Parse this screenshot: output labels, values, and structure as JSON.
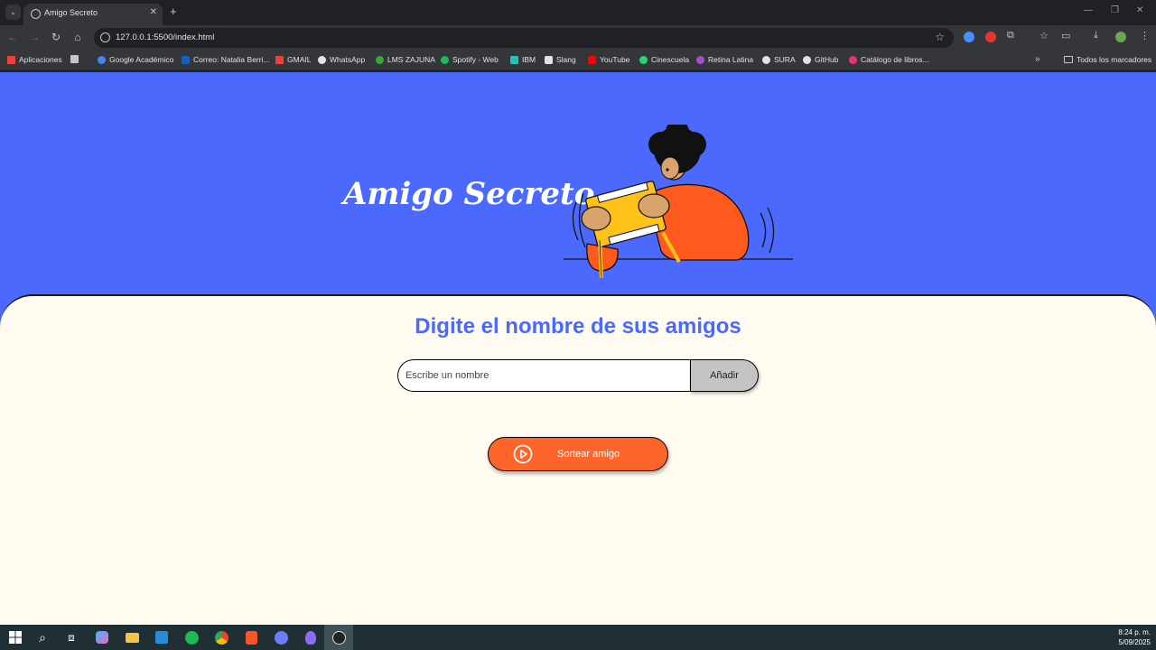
{
  "browser": {
    "tab_title": "Amigo Secreto",
    "url": "127.0.0.1:5500/index.html"
  },
  "bookmarks": {
    "items": [
      {
        "label": "Aplicaciones",
        "icon": "apps-grid-icon",
        "color": "#ea4335"
      },
      {
        "label": "Google Académico",
        "icon": "scholar-icon",
        "color": "#4285f4"
      },
      {
        "label": "Correo: Natalia Berri...",
        "icon": "outlook-icon",
        "color": "#0a64c8"
      },
      {
        "label": "GMAIL",
        "icon": "gmail-icon",
        "color": "#ea4335"
      },
      {
        "label": "WhatsApp",
        "icon": "whatsapp-icon",
        "color": "#e3e3e3"
      },
      {
        "label": "LMS ZAJUNA",
        "icon": "lms-icon",
        "color": "#39a935"
      },
      {
        "label": "Spotify - Web",
        "icon": "spotify-icon",
        "color": "#1db954"
      },
      {
        "label": "IBM",
        "icon": "ibm-icon",
        "color": "#22c3b5"
      },
      {
        "label": "Slang",
        "icon": "slang-icon",
        "color": "#e3e3e3"
      },
      {
        "label": "YouTube",
        "icon": "youtube-icon",
        "color": "#ff0000"
      },
      {
        "label": "Cinescuela",
        "icon": "cinescuela-icon",
        "color": "#2bd36e"
      },
      {
        "label": "Retina Latina",
        "icon": "retina-icon",
        "color": "#a64ed1"
      },
      {
        "label": "SURA",
        "icon": "sura-icon",
        "color": "#e3e3e3"
      },
      {
        "label": "GitHub",
        "icon": "github-icon",
        "color": "#e3e3e3"
      },
      {
        "label": "Catálogo de libros...",
        "icon": "catalog-icon",
        "color": "#e8336f"
      }
    ],
    "all_bookmarks_label": "Todos los marcadores"
  },
  "page": {
    "hero_title": "Amigo Secreto",
    "section_title": "Digite el nombre de sus amigos",
    "input_placeholder": "Escribe un nombre",
    "add_button_label": "Añadir",
    "draw_button_label": "Sortear amigo",
    "colors": {
      "hero_bg": "#4b69fd",
      "content_bg": "#fffbf0",
      "accent": "#fe652b",
      "title": "#4b69fd"
    }
  },
  "taskbar": {
    "time": "8:24 p. m.",
    "date": "5/09/2025"
  }
}
